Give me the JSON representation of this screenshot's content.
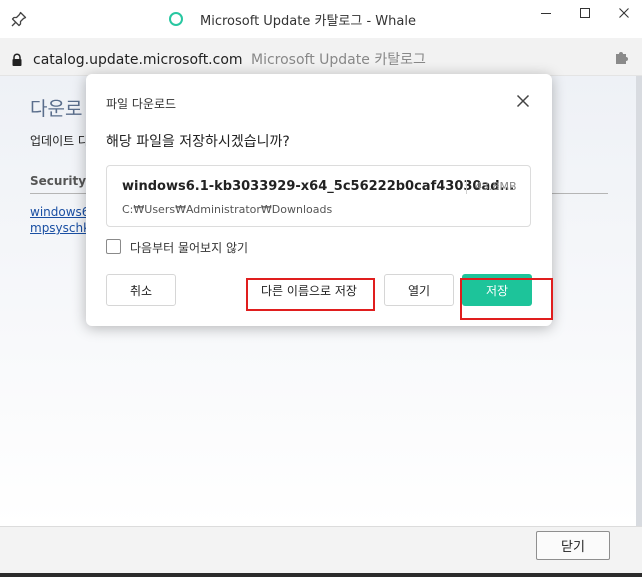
{
  "window": {
    "title": "Microsoft Update 카탈로그 - Whale",
    "controls": [
      "minimize",
      "maximize",
      "close"
    ]
  },
  "address_bar": {
    "host": "catalog.update.microsoft.com",
    "page_title": "Microsoft Update 카탈로그"
  },
  "background_page": {
    "heading": "다운로",
    "subtitle": "업데이트 다",
    "column_header": "Security U",
    "links": [
      "windows6.",
      "mpsyschk"
    ]
  },
  "dialog": {
    "title": "파일 다운로드",
    "question": "해당 파일을 저장하시겠습니까?",
    "file": {
      "name": "windows6.1-kb3033929-x64_5c56222b0caf43030ad...",
      "size": "43.8MB",
      "path": "C:₩Users₩Administrator₩Downloads"
    },
    "checkbox_label": "다음부터 물어보지 않기",
    "checkbox_checked": false,
    "buttons": {
      "cancel": "취소",
      "save_as": "다른 이름으로 저장",
      "open": "열기",
      "save": "저장"
    },
    "accent_color": "#1dc49a"
  },
  "footer": {
    "close_label": "닫기"
  },
  "annotations": {
    "highlight_color": "#e01e1e"
  }
}
